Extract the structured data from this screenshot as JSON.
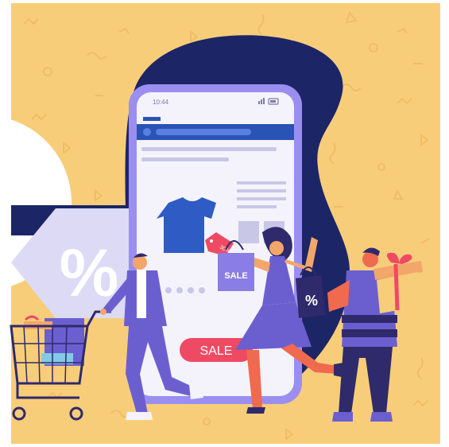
{
  "phone": {
    "time": "10:44",
    "sale_button_label": "SALE"
  },
  "tag": {
    "percent_symbol": "%"
  },
  "shopping_bags": {
    "sale_bag_label": "SALE",
    "percent_bag_label": "%"
  },
  "price_tag": {
    "label": "30%"
  },
  "colors": {
    "background": "#f8cd7a",
    "phone_backdrop": "#1c2566",
    "phone_frame": "#9a8ff0",
    "screen": "#f4f3fb",
    "header_blue": "#2a53b6",
    "tshirt": "#2e5bc4",
    "sale_pill": "#ef4a63",
    "accent_orange": "#f3a66a",
    "purple": "#6b5fd0"
  },
  "icons": [
    "signal-icon",
    "battery-icon",
    "tshirt-icon",
    "shopping-cart-icon",
    "gift-box-icon",
    "shopping-bag-icon",
    "price-tag-icon"
  ]
}
